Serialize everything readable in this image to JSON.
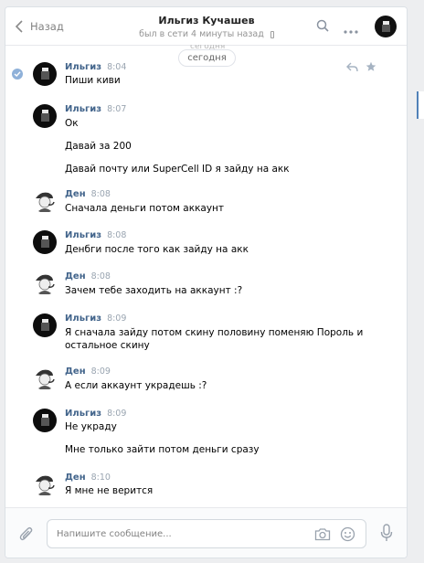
{
  "header": {
    "back_label": "Назад",
    "peer_name": "Ильгиз Кучашев",
    "peer_status": "был в сети 4 минуты назад"
  },
  "date_ghost": "сегодня",
  "date_pill": "сегодня",
  "messages": [
    {
      "author": "Ильгиз",
      "time": "8:04",
      "avatar": "dark",
      "lines": [
        "Пиши киви"
      ]
    },
    {
      "author": "Ильгиз",
      "time": "8:07",
      "avatar": "dark",
      "lines": [
        "Ок",
        "Давай за 200",
        "Давай почту или SuperCell ID я зайду на акк"
      ]
    },
    {
      "author": "Ден",
      "time": "8:08",
      "avatar": "light",
      "lines": [
        "Сначала деньги потом аккаунт"
      ]
    },
    {
      "author": "Ильгиз",
      "time": "8:08",
      "avatar": "dark",
      "lines": [
        "Денбги после того как зайду на акк"
      ]
    },
    {
      "author": "Ден",
      "time": "8:08",
      "avatar": "light",
      "lines": [
        "Зачем тебе заходить на аккаунт :?"
      ]
    },
    {
      "author": "Ильгиз",
      "time": "8:09",
      "avatar": "dark",
      "lines": [
        "Я сначала зайду потом скину половину поменяю Пороль и",
        "остальное скину"
      ]
    },
    {
      "author": "Ден",
      "time": "8:09",
      "avatar": "light",
      "lines": [
        "А если аккаунт украдешь :?"
      ]
    },
    {
      "author": "Ильгиз",
      "time": "8:09",
      "avatar": "dark",
      "lines": [
        "Не украду",
        "Мне только зайти потом деньги сразу"
      ]
    },
    {
      "author": "Ден",
      "time": "8:10",
      "avatar": "light",
      "lines": [
        "Я мне не верится"
      ]
    }
  ],
  "composer": {
    "placeholder": "Напишите сообщение..."
  },
  "colors": {
    "accent": "#5181b8",
    "author": "#42648b"
  },
  "icons": {
    "back": "chevron-left-icon",
    "search": "search-icon",
    "more": "more-icon",
    "reply": "reply-icon",
    "star": "star-icon",
    "attach": "paperclip-icon",
    "camera": "camera-icon",
    "smile": "smile-icon",
    "mic": "microphone-icon",
    "read": "read-check-icon"
  }
}
